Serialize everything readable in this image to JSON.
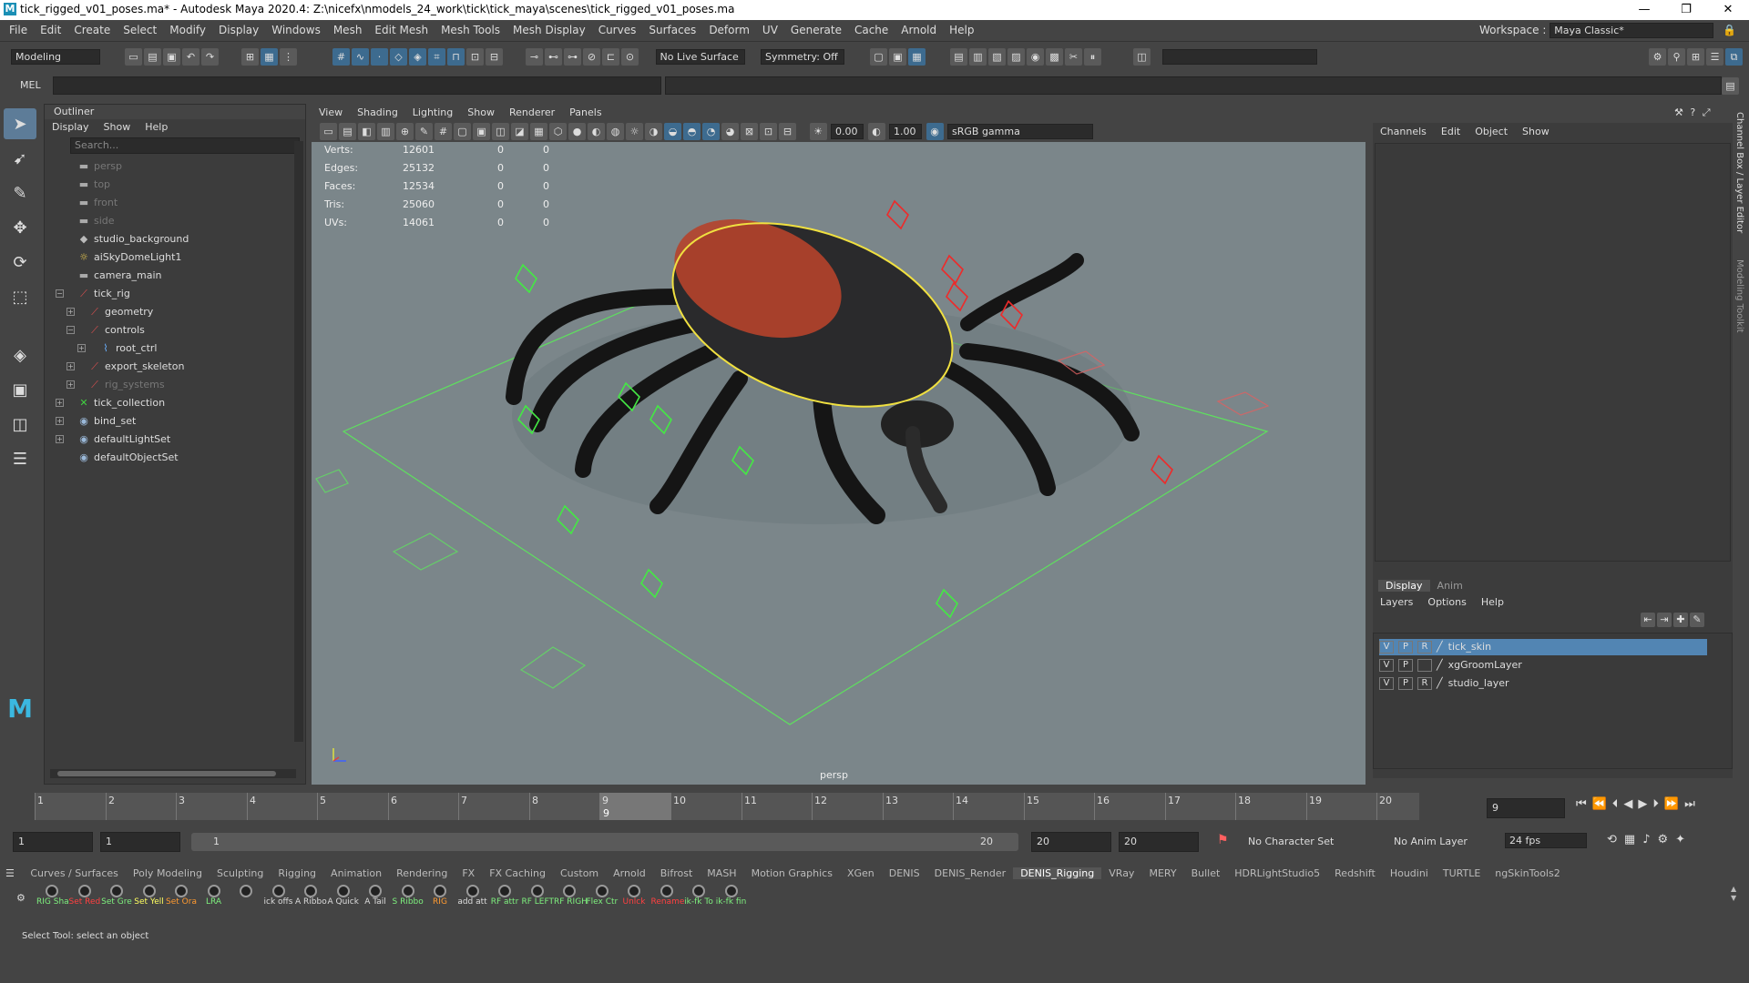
{
  "titlebar": {
    "title": "tick_rigged_v01_poses.ma* - Autodesk Maya 2020.4: Z:\\nicefx\\nmodels_24_work\\tick\\tick_maya\\scenes\\tick_rigged_v01_poses.ma",
    "minimize": "—",
    "maximize": "❐",
    "close": "✕"
  },
  "menubar": {
    "items": [
      "File",
      "Edit",
      "Create",
      "Select",
      "Modify",
      "Display",
      "Windows",
      "Mesh",
      "Edit Mesh",
      "Mesh Tools",
      "Mesh Display",
      "Curves",
      "Surfaces",
      "Deform",
      "UV",
      "Generate",
      "Cache",
      "Arnold",
      "Help"
    ],
    "workspace_label": "Workspace :",
    "workspace_value": "Maya Classic*"
  },
  "statusline": {
    "menuset": "Modeling",
    "live_surface": "No Live Surface",
    "symmetry": "Symmetry: Off"
  },
  "cmdline": {
    "label": "MEL"
  },
  "outliner": {
    "title": "Outliner",
    "menu": [
      "Display",
      "Show",
      "Help"
    ],
    "search_placeholder": "Search...",
    "rows": [
      {
        "label": "persp",
        "indent": 0,
        "icon": "camera-icon",
        "dim": true,
        "exp": ""
      },
      {
        "label": "top",
        "indent": 0,
        "icon": "camera-icon",
        "dim": true,
        "exp": ""
      },
      {
        "label": "front",
        "indent": 0,
        "icon": "camera-icon",
        "dim": true,
        "exp": ""
      },
      {
        "label": "side",
        "indent": 0,
        "icon": "camera-icon",
        "dim": true,
        "exp": ""
      },
      {
        "label": "studio_background",
        "indent": 0,
        "icon": "mesh-icon",
        "dim": false,
        "exp": ""
      },
      {
        "label": "aiSkyDomeLight1",
        "indent": 0,
        "icon": "light-icon",
        "dim": false,
        "exp": ""
      },
      {
        "label": "camera_main",
        "indent": 0,
        "icon": "camera-icon",
        "dim": false,
        "exp": ""
      },
      {
        "label": "tick_rig",
        "indent": 0,
        "icon": "group-icon",
        "dim": false,
        "exp": "−"
      },
      {
        "label": "geometry",
        "indent": 1,
        "icon": "group-icon",
        "dim": false,
        "exp": "+"
      },
      {
        "label": "controls",
        "indent": 1,
        "icon": "group-icon",
        "dim": false,
        "exp": "−"
      },
      {
        "label": "root_ctrl",
        "indent": 2,
        "icon": "curve-icon",
        "dim": false,
        "exp": "+"
      },
      {
        "label": "export_skeleton",
        "indent": 1,
        "icon": "group-icon",
        "dim": false,
        "exp": "+"
      },
      {
        "label": "rig_systems",
        "indent": 1,
        "icon": "group-icon",
        "dim": true,
        "exp": "+"
      },
      {
        "label": "tick_collection",
        "indent": 0,
        "icon": "collection-icon",
        "dim": false,
        "exp": "+"
      },
      {
        "label": "bind_set",
        "indent": 0,
        "icon": "set-icon",
        "dim": false,
        "exp": "+"
      },
      {
        "label": "defaultLightSet",
        "indent": 0,
        "icon": "set-icon",
        "dim": false,
        "exp": "+"
      },
      {
        "label": "defaultObjectSet",
        "indent": 0,
        "icon": "set-icon",
        "dim": false,
        "exp": ""
      }
    ]
  },
  "viewport": {
    "menu": [
      "View",
      "Shading",
      "Lighting",
      "Show",
      "Renderer",
      "Panels"
    ],
    "exposure": "0.00",
    "gamma": "1.00",
    "colorspace": "sRGB gamma",
    "camera_label": "persp",
    "hud": [
      {
        "label": "Verts:",
        "v": "12601",
        "a": "0",
        "b": "0"
      },
      {
        "label": "Edges:",
        "v": "25132",
        "a": "0",
        "b": "0"
      },
      {
        "label": "Faces:",
        "v": "12534",
        "a": "0",
        "b": "0"
      },
      {
        "label": "Tris:",
        "v": "25060",
        "a": "0",
        "b": "0"
      },
      {
        "label": "UVs:",
        "v": "14061",
        "a": "0",
        "b": "0"
      }
    ]
  },
  "channelbox": {
    "menu": [
      "Channels",
      "Edit",
      "Object",
      "Show"
    ],
    "layer_tabs": [
      "Display",
      "Anim"
    ],
    "layer_menu": [
      "Layers",
      "Options",
      "Help"
    ],
    "layers": [
      {
        "v": "V",
        "p": "P",
        "r": "R",
        "name": "tick_skin",
        "selected": true
      },
      {
        "v": "V",
        "p": "P",
        "r": "",
        "name": "xgGroomLayer",
        "selected": false
      },
      {
        "v": "V",
        "p": "P",
        "r": "R",
        "name": "studio_layer",
        "selected": false
      }
    ],
    "side_tabs": [
      "Channel Box / Layer Editor",
      "Modeling Toolkit"
    ]
  },
  "timeslider": {
    "ticks": [
      "1",
      "2",
      "3",
      "4",
      "5",
      "6",
      "7",
      "8",
      "9",
      "10",
      "11",
      "12",
      "13",
      "14",
      "15",
      "16",
      "17",
      "18",
      "19",
      "20"
    ],
    "current": "9",
    "current_field": "9"
  },
  "rangeslider": {
    "start": "1",
    "playback_start": "1",
    "range_label": "1",
    "range_end": "20",
    "playback_end": "20",
    "end": "20",
    "character_set": "No Character Set",
    "anim_layer": "No Anim Layer",
    "fps": "24 fps"
  },
  "shelf": {
    "tabs": [
      "Curves / Surfaces",
      "Poly Modeling",
      "Sculpting",
      "Rigging",
      "Animation",
      "Rendering",
      "FX",
      "FX Caching",
      "Custom",
      "Arnold",
      "Bifrost",
      "MASH",
      "Motion Graphics",
      "XGen",
      "DENIS",
      "DENIS_Render",
      "DENIS_Rigging",
      "VRay",
      "MERY",
      "Bullet",
      "HDRLightStudio5",
      "Redshift",
      "Houdini",
      "TURTLE",
      "ngSkinTools2"
    ],
    "active_tab": "DENIS_Rigging",
    "buttons": [
      {
        "label": "RIG Sha",
        "color": "#7ef07e"
      },
      {
        "label": "Set Red",
        "color": "#ff4040"
      },
      {
        "label": "Set Gre",
        "color": "#7ef07e"
      },
      {
        "label": "Set Yell",
        "color": "#ffff60"
      },
      {
        "label": "Set Ora",
        "color": "#ff9a30"
      },
      {
        "label": "LRA",
        "color": "#7ef07e"
      },
      {
        "label": "",
        "color": "#ddd"
      },
      {
        "label": "ick offs",
        "color": "#ddd"
      },
      {
        "label": "A Ribbo",
        "color": "#ddd"
      },
      {
        "label": "A Quick",
        "color": "#ddd"
      },
      {
        "label": "A Tail",
        "color": "#ddd"
      },
      {
        "label": "S Ribbo",
        "color": "#7ef07e"
      },
      {
        "label": "RIG",
        "color": "#ff9a30"
      },
      {
        "label": "add att",
        "color": "#ddd"
      },
      {
        "label": "RF attr",
        "color": "#7ef07e"
      },
      {
        "label": "RF LEFT",
        "color": "#7ef07e"
      },
      {
        "label": "RF RIGH",
        "color": "#7ef07e"
      },
      {
        "label": "Flex Ctr",
        "color": "#7ef07e"
      },
      {
        "label": "Unlck",
        "color": "#ff4040"
      },
      {
        "label": "Rename",
        "color": "#ff4040"
      },
      {
        "label": "ik-fk To",
        "color": "#7ef07e"
      },
      {
        "label": "ik-fk fin",
        "color": "#7ef07e"
      }
    ]
  },
  "helpline": {
    "text": "Select Tool: select an object"
  }
}
